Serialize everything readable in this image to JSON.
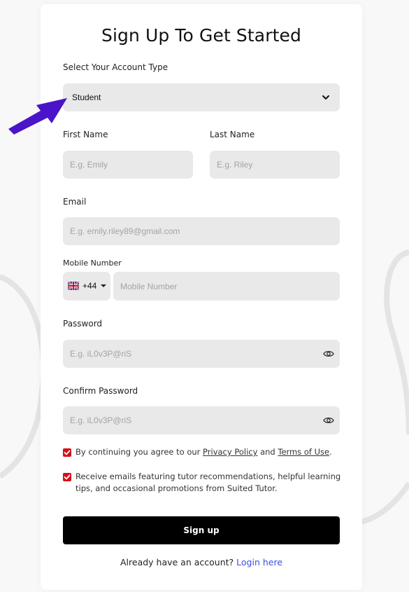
{
  "form": {
    "title": "Sign Up To Get Started",
    "account_type": {
      "label": "Select Your Account Type",
      "value": "Student"
    },
    "first_name": {
      "label": "First Name",
      "placeholder": "E.g. Emily"
    },
    "last_name": {
      "label": "Last Name",
      "placeholder": "E.g. Riley"
    },
    "email": {
      "label": "Email",
      "placeholder": "E.g. emily.riley89@gmail.com"
    },
    "mobile": {
      "label": "Mobile Number",
      "country_code": "+44",
      "placeholder": "Mobile Number",
      "flag_icon": "uk-flag-icon"
    },
    "password": {
      "label": "Password",
      "placeholder": "E.g. iL0v3P@riS"
    },
    "confirm_password": {
      "label": "Confirm Password",
      "placeholder": "E.g. iL0v3P@riS"
    },
    "consent": {
      "prefix": "By continuing you agree to our ",
      "privacy_link": "Privacy Policy",
      "and": " and ",
      "terms_link": "Terms of Use",
      "suffix": ".",
      "checked": true
    },
    "marketing": {
      "text": "Receive emails featuring tutor recommendations, helpful learning tips, and occasional promotions from Suited Tutor.",
      "checked": true
    },
    "submit_label": "Sign up",
    "login_prompt": "Already have an account? ",
    "login_link": "Login here"
  },
  "colors": {
    "checkbox": "#d3111b",
    "link": "#3a4fe0",
    "arrow": "#4a14c8",
    "button": "#000000"
  },
  "icons": [
    "chevron-down-icon",
    "uk-flag-icon",
    "eye-icon",
    "checkmark-icon",
    "pointer-arrow-icon"
  ]
}
